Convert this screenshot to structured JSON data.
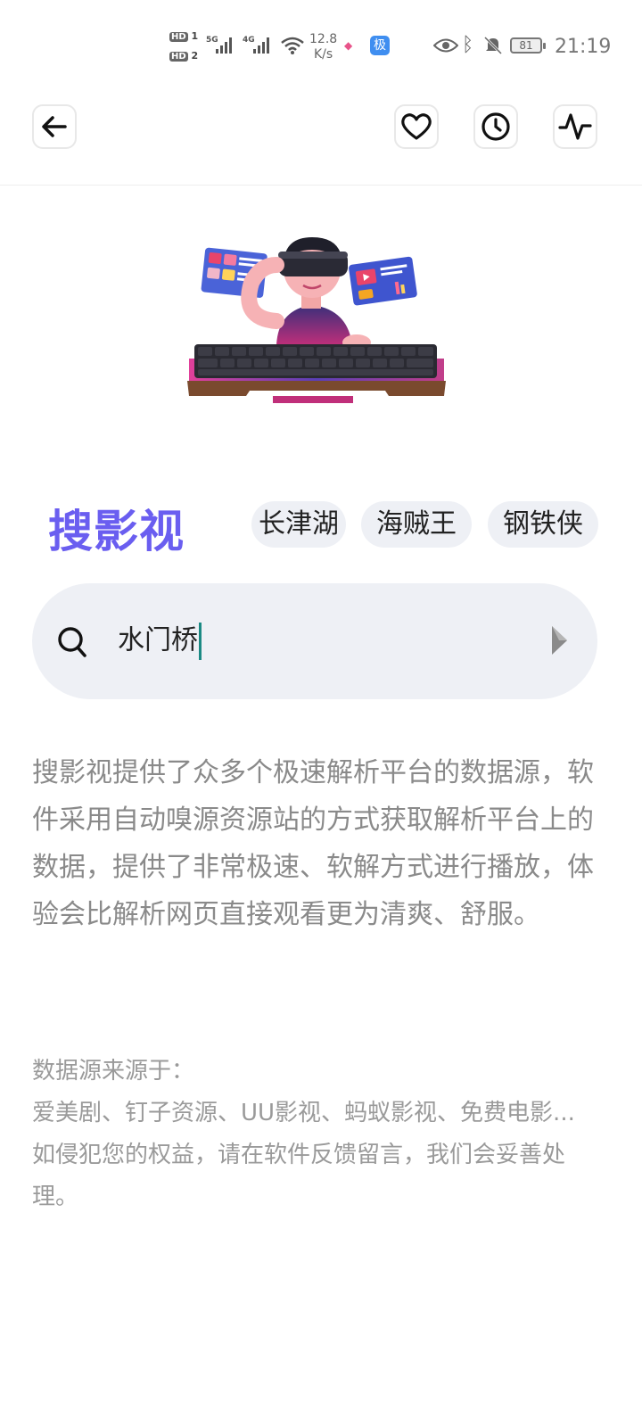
{
  "status_bar": {
    "hd1": "HD",
    "hd1_num": "1",
    "hd2": "HD",
    "hd2_num": "2",
    "net1": "5G",
    "net2": "4G",
    "speed_value": "12.8",
    "speed_unit": "K/s",
    "app_badge": "极",
    "battery": "81",
    "time": "21:19"
  },
  "nav": {
    "back_icon": "arrow-left-icon",
    "favorite_icon": "heart-icon",
    "history_icon": "clock-icon",
    "activity_icon": "pulse-icon"
  },
  "brand": {
    "title": "搜影视",
    "color": "#6a5ef0"
  },
  "hot_tags": [
    {
      "label": "长津湖"
    },
    {
      "label": "海贼王"
    },
    {
      "label": "钢铁侠"
    }
  ],
  "search": {
    "value": "水门桥",
    "search_icon": "search-icon",
    "go_icon": "play-arrow-icon"
  },
  "description": "搜影视提供了众多个极速解析平台的数据源，软件采用自动嗅源资源站的方式获取解析平台上的数据，提供了非常极速、软解方式进行播放，体验会比解析网页直接观看更为清爽、舒服。",
  "sources": {
    "heading": "数据源来源于：",
    "list": "爱美剧、钉子资源、UU影视、蚂蚁影视、免费电影...",
    "notice": "如侵犯您的权益，请在软件反馈留言，我们会妥善处理。"
  }
}
